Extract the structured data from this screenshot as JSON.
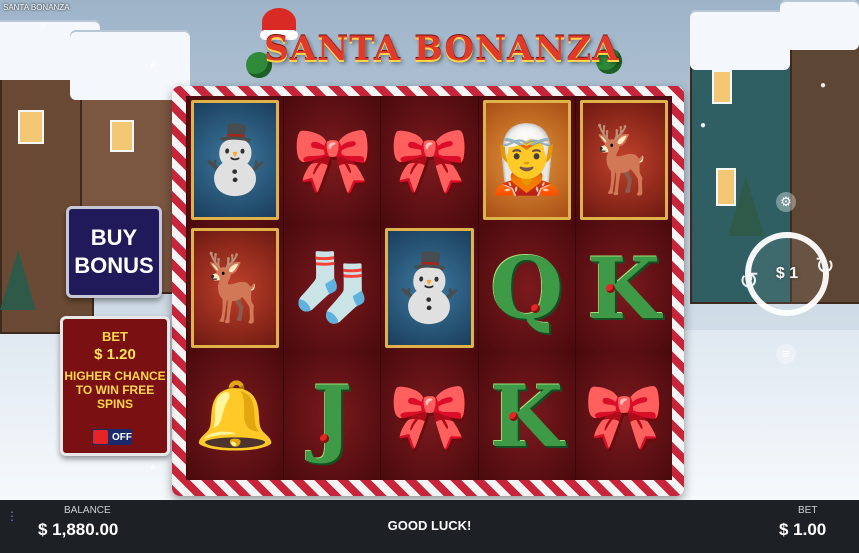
{
  "window_title": "SANTA BONANZA",
  "game_title": "SANTA BONANZA",
  "buy_bonus": {
    "line1": "BUY",
    "line2": "BONUS"
  },
  "bet_panel": {
    "label": "BET",
    "amount": "$ 1.20",
    "description": "HIGHER CHANCE TO WIN FREE SPINS",
    "toggle_state": "OFF"
  },
  "spin_button": {
    "bet_display": "$ 1"
  },
  "footer": {
    "balance_label": "BALANCE",
    "balance_value": "$ 1,880.00",
    "message": "GOOD LUCK!",
    "bet_label": "BET",
    "bet_value": "$ 1.00"
  },
  "reels": [
    [
      "snowman",
      "reindeer",
      "bell"
    ],
    [
      "bow",
      "stocking",
      "J"
    ],
    [
      "bow",
      "snowman",
      "bow"
    ],
    [
      "elf",
      "Q",
      "K"
    ],
    [
      "reindeer",
      "K",
      "bow"
    ]
  ],
  "colors": {
    "accent_red": "#c8243a",
    "gold": "#ffd84a",
    "reel_bg": "#5a0f12",
    "buy_bonus_bg": "#20195a",
    "footer_bg": "#1d2025"
  }
}
